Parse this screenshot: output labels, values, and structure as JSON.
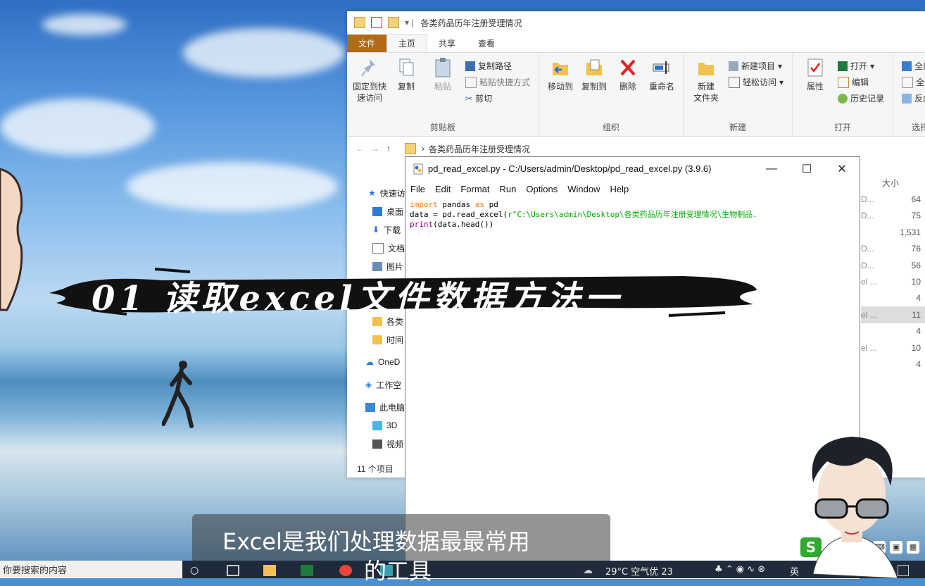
{
  "explorer": {
    "title": "各类药品历年注册受理情况",
    "tabs": [
      "文件",
      "主页",
      "共享",
      "查看"
    ],
    "ribbon": {
      "clipboard": {
        "pin_label_1": "固定到快",
        "pin_label_2": "速访问",
        "copy": "复制",
        "paste": "粘贴",
        "copy_path": "复制路径",
        "paste_shortcut": "粘贴快捷方式",
        "cut": "剪切",
        "group": "剪贴板"
      },
      "organize": {
        "move_to": "移动到",
        "copy_to": "复制到",
        "delete": "删除",
        "rename": "重命名",
        "group": "组织"
      },
      "new": {
        "new_folder_1": "新建",
        "new_folder_2": "文件夹",
        "new_item": "新建项目",
        "easy_access": "轻松访问",
        "group": "新建"
      },
      "open": {
        "properties": "属性",
        "open": "打开",
        "edit": "编辑",
        "history": "历史记录",
        "group": "打开"
      },
      "select": {
        "all": "全部",
        "none": "全部",
        "invert": "反向",
        "group": "选择"
      }
    },
    "address": "各类药品历年注册受理情况",
    "nav_items": [
      "快速访",
      "桌面",
      "下载",
      "文档",
      "图片",
      "",
      "",
      "各类",
      "时间",
      "OneD",
      "工作空",
      "此电脑",
      "3D",
      "视频"
    ],
    "size_header": "大小",
    "rows": [
      {
        "type": "D...",
        "size": "64"
      },
      {
        "type": "D...",
        "size": "75"
      },
      {
        "type": "",
        "size": "1,531"
      },
      {
        "type": "D...",
        "size": "76"
      },
      {
        "type": "D...",
        "size": "56"
      },
      {
        "type": "el ...",
        "size": "10"
      },
      {
        "type": "",
        "size": "4"
      },
      {
        "type": "el ...",
        "size": "11"
      },
      {
        "type": "",
        "size": "4"
      },
      {
        "type": "el ...",
        "size": "10"
      },
      {
        "type": "",
        "size": "4"
      }
    ],
    "status": "11 个项目"
  },
  "idle": {
    "title": "pd_read_excel.py - C:/Users/admin/Desktop/pd_read_excel.py (3.9.6)",
    "menu": [
      "File",
      "Edit",
      "Format",
      "Run",
      "Options",
      "Window",
      "Help"
    ],
    "code": {
      "l1_kw1": "import",
      "l1_mid": " pandas ",
      "l1_kw2": "as",
      "l1_end": " pd",
      "l2_start": "data = pd.read_excel(",
      "l2_str": "r\"C:\\Users\\admin\\Desktop\\各类药品历年注册受理情况\\生物制品.",
      "l3_bi": "print",
      "l3_end": "(data.head())"
    }
  },
  "banner": "01 读取excel文件数据方法一",
  "subtitle": {
    "line1": "Excel是我们处理数据最最常用",
    "line2": "的工具"
  },
  "taskbar": {
    "search_placeholder": "你要搜索的内容",
    "weather": "29°C  空气优 23",
    "lang": "英"
  },
  "ime": {
    "logo": "S"
  }
}
